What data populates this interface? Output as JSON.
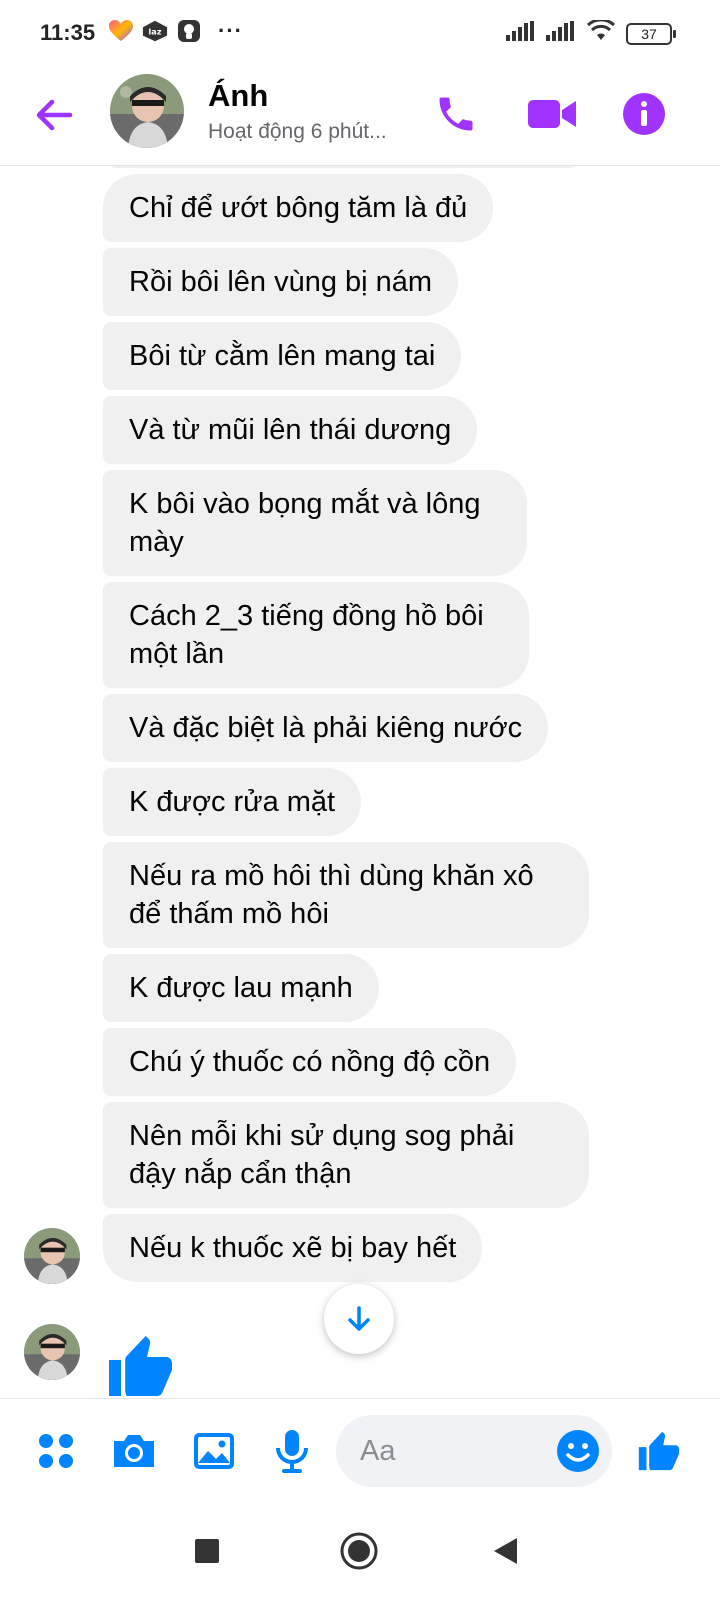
{
  "status_bar": {
    "time": "11:35",
    "more": "···",
    "battery": "37"
  },
  "header": {
    "name": "Ánh",
    "activity": "Hoạt động 6 phút..."
  },
  "messages": [
    "Chỉ để ướt bông tăm là đủ",
    "Rồi bôi lên vùng bị nám",
    "Bôi từ cằm lên mang tai",
    "Và từ mũi lên thái dương",
    "K bôi vào bọng mắt và lông mày",
    "Cách 2_3 tiếng đồng hồ bôi một lần",
    "Và đặc biệt là phải kiêng nước",
    "K được rửa mặt",
    "Nếu ra mồ hôi thì dùng khăn xô để thấm mồ hôi",
    "K được lau mạnh",
    "Chú ý thuốc có nồng độ cồn",
    "Nên mỗi khi sử dụng sog phải đậy nắp cẩn thận",
    "Nếu k thuốc xẽ bị bay hết"
  ],
  "composer": {
    "placeholder": "Aa"
  },
  "colors": {
    "accent_purple": "#a033ff",
    "accent_blue": "#0084ff",
    "bubble_bg": "#f0f0f0"
  },
  "icons": {
    "back": "arrow-left-icon",
    "call": "phone-icon",
    "video": "video-camera-icon",
    "info": "info-icon",
    "scroll": "arrow-down-icon",
    "like": "thumbs-up-icon",
    "menu": "four-dots-icon",
    "camera": "camera-icon",
    "gallery": "image-icon",
    "mic": "microphone-icon",
    "emoji": "smiley-icon"
  }
}
